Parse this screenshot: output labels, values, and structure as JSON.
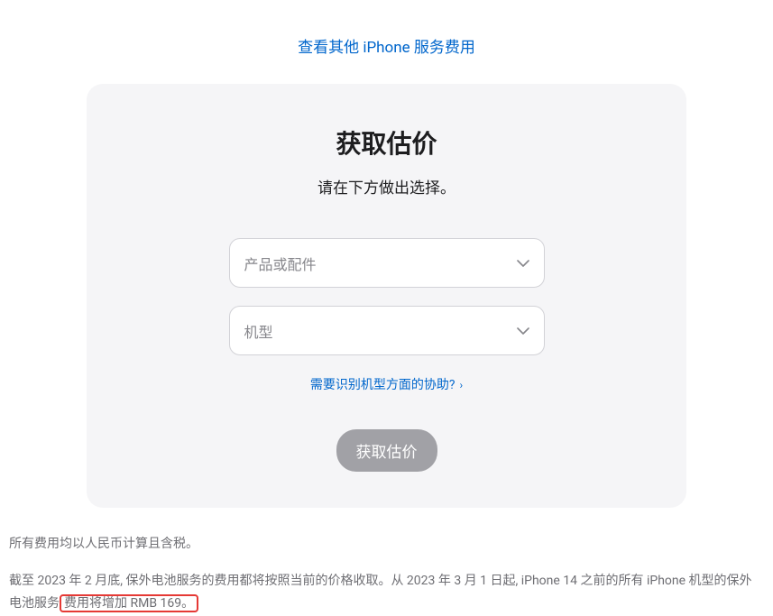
{
  "topLink": {
    "label": "查看其他 iPhone 服务费用"
  },
  "card": {
    "title": "获取估价",
    "subtitle": "请在下方做出选择。",
    "selectProduct": {
      "placeholder": "产品或配件"
    },
    "selectModel": {
      "placeholder": "机型"
    },
    "helpLink": {
      "label": "需要识别机型方面的协助?"
    },
    "submitButton": {
      "label": "获取估价"
    }
  },
  "footer": {
    "line1": "所有费用均以人民币计算且含税。",
    "line2_a": "截至 2023 年 2 月底, 保外电池服务的费用都将按照当前的价格收取。从 2023 年 3 月 1 日起, iPhone 14 之前的所有 iPhone 机型的保外电池服务",
    "line2_b": "费用将增加 RMB 169。"
  }
}
